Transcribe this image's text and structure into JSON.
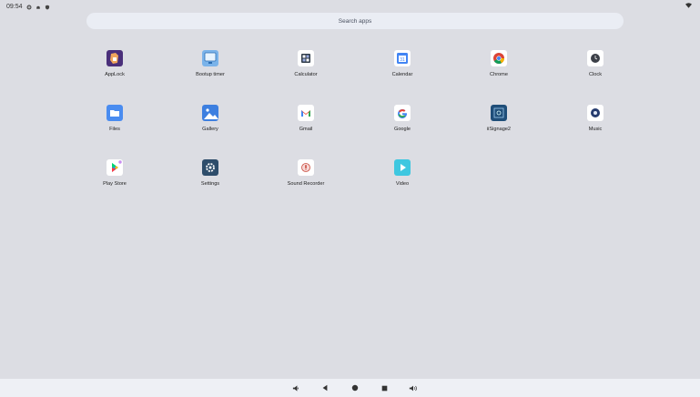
{
  "status": {
    "time": "09:54"
  },
  "search": {
    "placeholder": "Search apps"
  },
  "apps": [
    {
      "label": "AppLock",
      "icon": "applock-icon"
    },
    {
      "label": "Bootup timer",
      "icon": "bootup-timer-icon"
    },
    {
      "label": "Calculator",
      "icon": "calculator-icon"
    },
    {
      "label": "Calendar",
      "icon": "calendar-icon"
    },
    {
      "label": "Chrome",
      "icon": "chrome-icon"
    },
    {
      "label": "Clock",
      "icon": "clock-icon"
    },
    {
      "label": "Files",
      "icon": "files-icon"
    },
    {
      "label": "Gallery",
      "icon": "gallery-icon"
    },
    {
      "label": "Gmail",
      "icon": "gmail-icon"
    },
    {
      "label": "Google",
      "icon": "google-icon"
    },
    {
      "label": "iiSignage2",
      "icon": "iisignage-icon"
    },
    {
      "label": "Music",
      "icon": "music-icon"
    },
    {
      "label": "Play Store",
      "icon": "play-store-icon"
    },
    {
      "label": "Settings",
      "icon": "settings-icon"
    },
    {
      "label": "Sound Recorder",
      "icon": "sound-recorder-icon"
    },
    {
      "label": "Video",
      "icon": "video-icon"
    }
  ],
  "colors": {
    "background": "#dcdde3",
    "search_bg": "#eaedf4",
    "navbar_bg": "#eef0f5"
  }
}
